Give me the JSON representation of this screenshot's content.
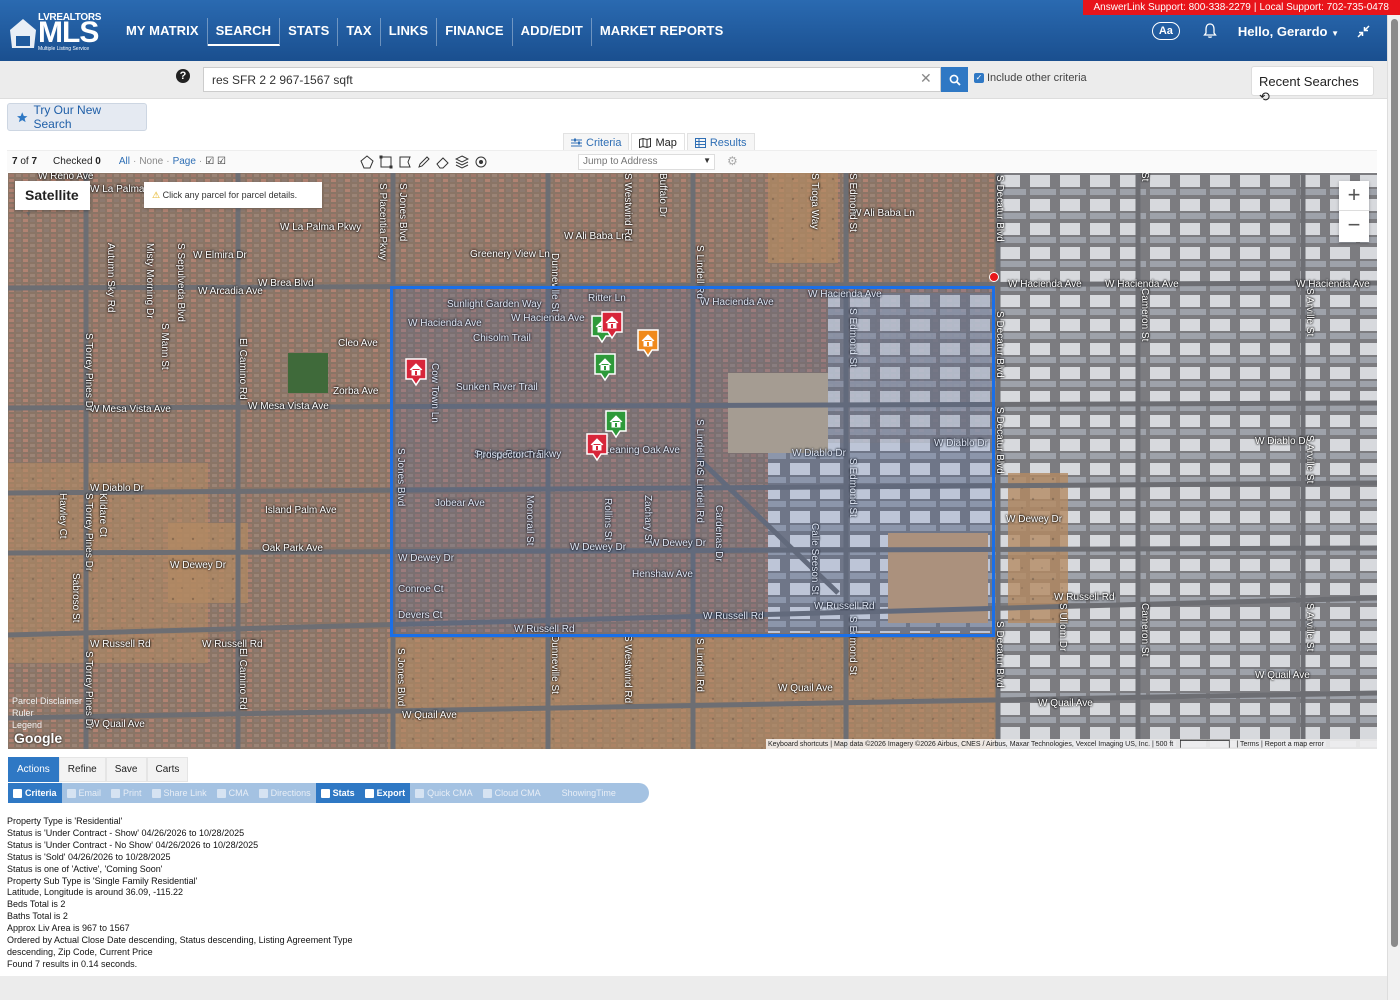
{
  "support": {
    "answerlink": "AnswerLink Support: 800-338-2279",
    "local": "Local Support: 702-735-0478"
  },
  "logo": {
    "top": "LVREALTORS",
    "main": "MLS",
    "sub": "Multiple Listing Service"
  },
  "nav": {
    "items": [
      "MY MATRIX",
      "SEARCH",
      "STATS",
      "TAX",
      "LINKS",
      "FINANCE",
      "ADD/EDIT",
      "MARKET REPORTS"
    ],
    "active": "SEARCH"
  },
  "header": {
    "aa": "Aa",
    "greeting": "Hello, Gerardo"
  },
  "search": {
    "value": "res SFR 2 2 967-1567 sqft",
    "include_label": "Include other criteria",
    "recent_label": "Recent Searches"
  },
  "try_new": "Try Our New Search",
  "view_tabs": [
    "Criteria",
    "Map",
    "Results"
  ],
  "toolbar": {
    "count": "7",
    "of": "of",
    "total": "7",
    "checked_label": "Checked",
    "checked": "0",
    "all": "All",
    "none": "None",
    "page": "Page",
    "jump_placeholder": "Jump to Address"
  },
  "map": {
    "type_button": "Satellite",
    "hint": "Click any parcel for parcel details.",
    "zoom_in": "+",
    "zoom_out": "−",
    "bottom_left": [
      "Parcel Disclaimer",
      "Ruler",
      "Legend"
    ],
    "google": "Google",
    "attribution": "Keyboard shortcuts   |   Map data ©2026 Imagery ©2026 Airbus, CNES / Airbus, Maxar Technologies, Vexcel Imaging US, Inc.   |   500 ft   ▕▔▔▔▔▔▔▔▔▔▏   |   Terms   |   Report a map error",
    "roads": [
      "W Reno Ave",
      "W La Palma",
      "W La Palma Pkwy",
      "W Ali Baba Ln",
      "W Ali Baba Ln",
      "Greenery View Ln",
      "W Elmira Dr",
      "W Brea Blvd",
      "W Arcadia Ave",
      "Sunlight Garden Way",
      "Ritter Ln",
      "W Hacienda Ave",
      "W Hacienda Ave",
      "W Hacienda Ave",
      "W Hacienda Ave",
      "W Hacienda Ave",
      "W Hacienda Ave",
      "W Hacienda Ave",
      "Chisolm Trail",
      "Cleo Ave",
      "Zorba Ave",
      "W Mesa Vista Ave",
      "W Mesa Vista Ave",
      "Sunken River Trail",
      "Spring Ranch Pkwy",
      "Prospector Trail",
      "Leaning Oak Ave",
      "W Diablo Dr",
      "W Diablo Dr",
      "W Diablo Dr",
      "W Diablo Dr",
      "Jobear Ave",
      "Island Palm Ave",
      "Oak Park Ave",
      "W Dewey Dr",
      "W Dewey Dr",
      "W Dewey Dr",
      "W Dewey Dr",
      "W Dewey Dr",
      "Henshaw Ave",
      "Conroe Ct",
      "Devers Ct",
      "W Russell Rd",
      "W Russell Rd",
      "W Russell Rd",
      "W Russell Rd",
      "W Russell Rd",
      "W Russell Rd",
      "W Quail Ave",
      "W Quail Ave",
      "W Quail Ave",
      "W Quail Ave",
      "W Quail Ave",
      "S Decatur Blvd",
      "S Decatur Blvd",
      "S Decatur Blvd",
      "S Decatur Blvd",
      "S Jones Blvd",
      "S Jones Blvd",
      "S Jones Blvd",
      "S Lindell Rd",
      "S Lindell Rd",
      "S Lindell Rd",
      "S Lindell Rd",
      "S Edmond St",
      "S Edmond St",
      "S Edmond St",
      "S Edmond St",
      "S Westwind Rd",
      "S Westwind Rd",
      "Dunneville St",
      "Dunneville St",
      "S Placentia Pkwy",
      "S Sepulveda Blvd",
      "Misty Morning Dr",
      "Autumn Sky Rd",
      "S Torrey Pines Dr",
      "S Torrey Pines Dr",
      "S Torrey Pines Dr",
      "S Mann St",
      "El Camino Rd",
      "El Camino Rd",
      "Cameron St",
      "Cameron St",
      "Cameron St",
      "S Arville St",
      "S Arville St",
      "S Arville St",
      "S Ullom Dr",
      "Calle Seeson St",
      "Zachary St",
      "Rollins St",
      "Monorail St",
      "Cow Town Ln",
      "Cardenas Dr",
      "Hawley Ct",
      "Kildare Ct",
      "Sabroso St",
      "S Tioga Way",
      "Buffalo Dr"
    ]
  },
  "bottom_tabs": [
    "Actions",
    "Refine",
    "Save",
    "Carts"
  ],
  "actions": [
    "Criteria",
    "Email",
    "Print",
    "Share Link",
    "CMA",
    "Directions",
    "Stats",
    "Export",
    "Quick CMA",
    "Cloud CMA",
    "ShowingTime"
  ],
  "criteria_lines": [
    "Property Type is 'Residential'",
    "Status is 'Under Contract - Show' 04/26/2026 to 10/28/2025",
    "Status is 'Under Contract - No Show' 04/26/2026 to 10/28/2025",
    "Status is 'Sold' 04/26/2026 to 10/28/2025",
    "Status is one of 'Active', 'Coming Soon'",
    "Property Sub Type is 'Single Family Residential'",
    "Latitude, Longitude is around 36.09, -115.22",
    "Beds Total is 2",
    "Baths Total is 2",
    "Approx Liv Area is 967 to 1567",
    "Ordered by Actual Close Date descending, Status descending, Listing Agreement Type",
    "descending, Zip Code, Current Price",
    "Found 7 results in 0.14 seconds."
  ],
  "pins": [
    {
      "status": "active",
      "color": "#2e9a3a"
    },
    {
      "status": "sold",
      "color": "#d8263a"
    },
    {
      "status": "coming-soon",
      "color": "#f08a1c"
    },
    {
      "status": "sold",
      "color": "#d8263a"
    },
    {
      "status": "active",
      "color": "#2e9a3a"
    },
    {
      "status": "active",
      "color": "#2e9a3a"
    },
    {
      "status": "sold",
      "color": "#d8263a"
    }
  ],
  "colors": {
    "nav": "#1f5a9e",
    "accent": "#2f78c4",
    "support": "#e8141b",
    "drawbox": "#1a6fe8"
  }
}
